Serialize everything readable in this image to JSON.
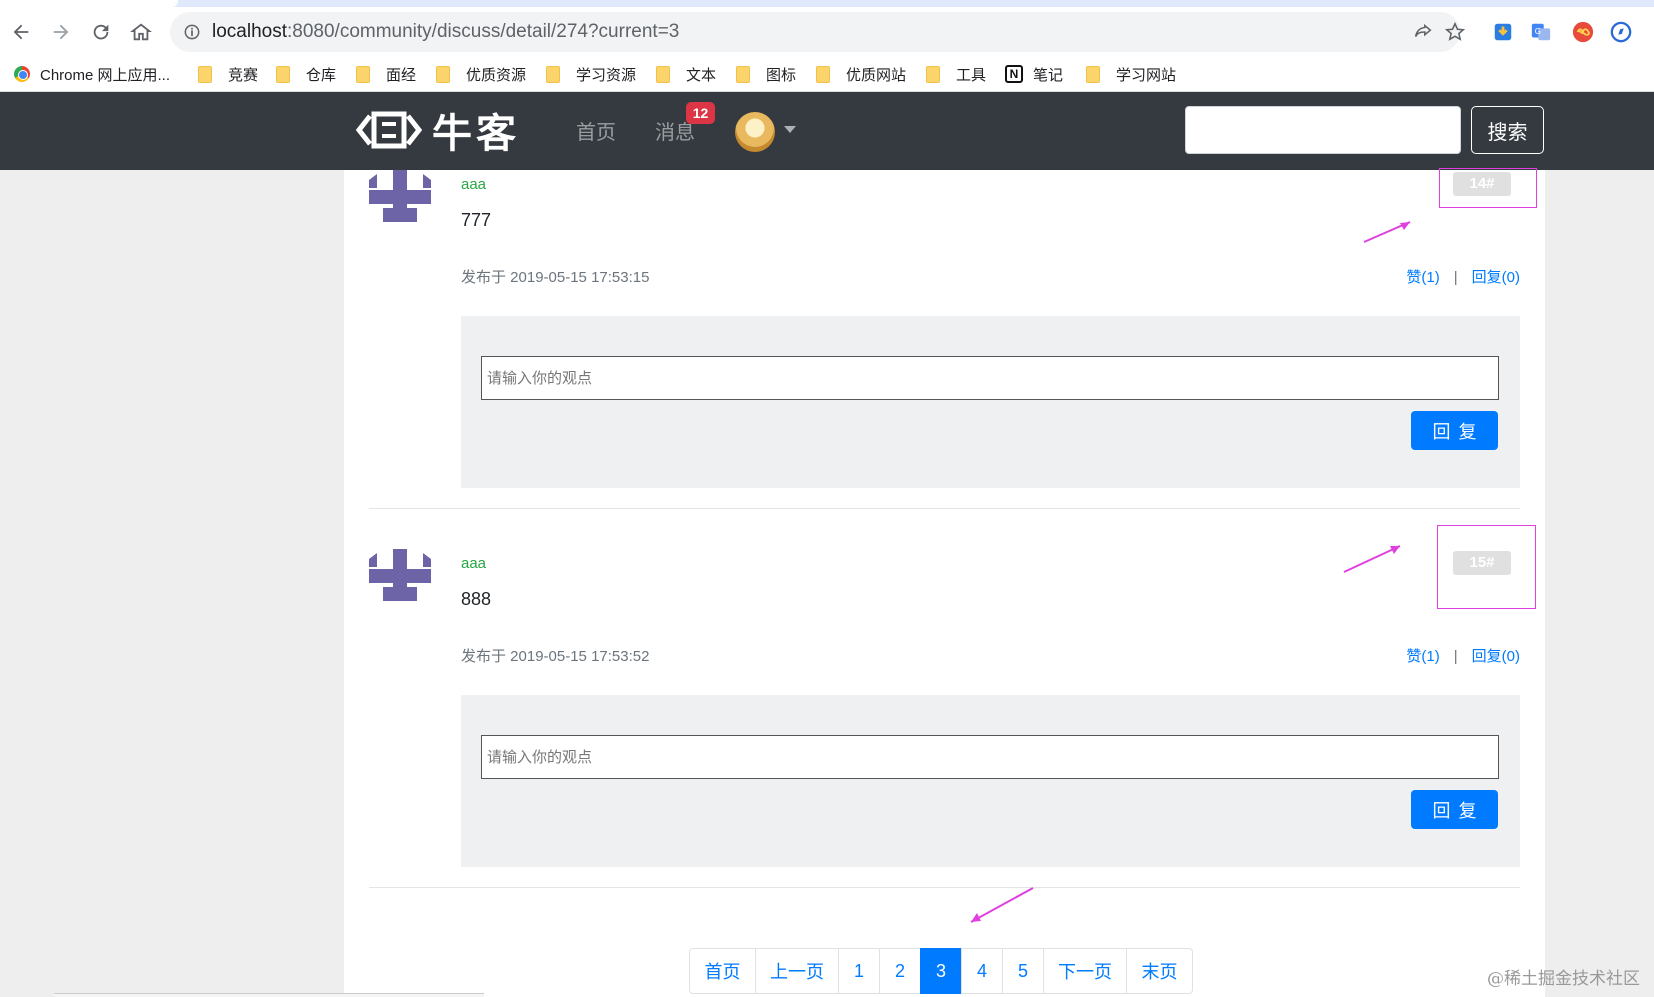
{
  "browser": {
    "url_host": "localhost",
    "url_path": ":8080/community/discuss/detail/274?current=3",
    "bookmarks": [
      "Chrome 网上应用...",
      "竞赛",
      "仓库",
      "面经",
      "优质资源",
      "学习资源",
      "文本",
      "图标",
      "优质网站",
      "工具",
      "笔记",
      "学习网站"
    ]
  },
  "navbar": {
    "logo_text": "牛客",
    "home_label": "首页",
    "messages_label": "消息",
    "messages_count": "12",
    "search_placeholder": "",
    "search_button": "搜索"
  },
  "comments": [
    {
      "user": "aaa",
      "text": "777",
      "floor": "14#",
      "time": "发布于 2019-05-15 17:53:15",
      "like": "赞(1)",
      "reply": "回复(0)",
      "separator": "|",
      "reply_placeholder": "请输入你的观点",
      "reply_button": "回复"
    },
    {
      "user": "aaa",
      "text": "888",
      "floor": "15#",
      "time": "发布于 2019-05-15 17:53:52",
      "like": "赞(1)",
      "reply": "回复(0)",
      "separator": "|",
      "reply_placeholder": "请输入你的观点",
      "reply_button": "回复"
    }
  ],
  "pagination": {
    "first": "首页",
    "prev": "上一页",
    "pages": [
      "1",
      "2",
      "3",
      "4",
      "5"
    ],
    "active": "3",
    "next": "下一页",
    "last": "末页"
  },
  "watermark": "@稀土掘金技术社区",
  "colors": {
    "navbar_bg": "#343a40",
    "accent": "#007bff",
    "username": "#28a745",
    "badge": "#dc3545",
    "annotation": "#e040e0"
  }
}
